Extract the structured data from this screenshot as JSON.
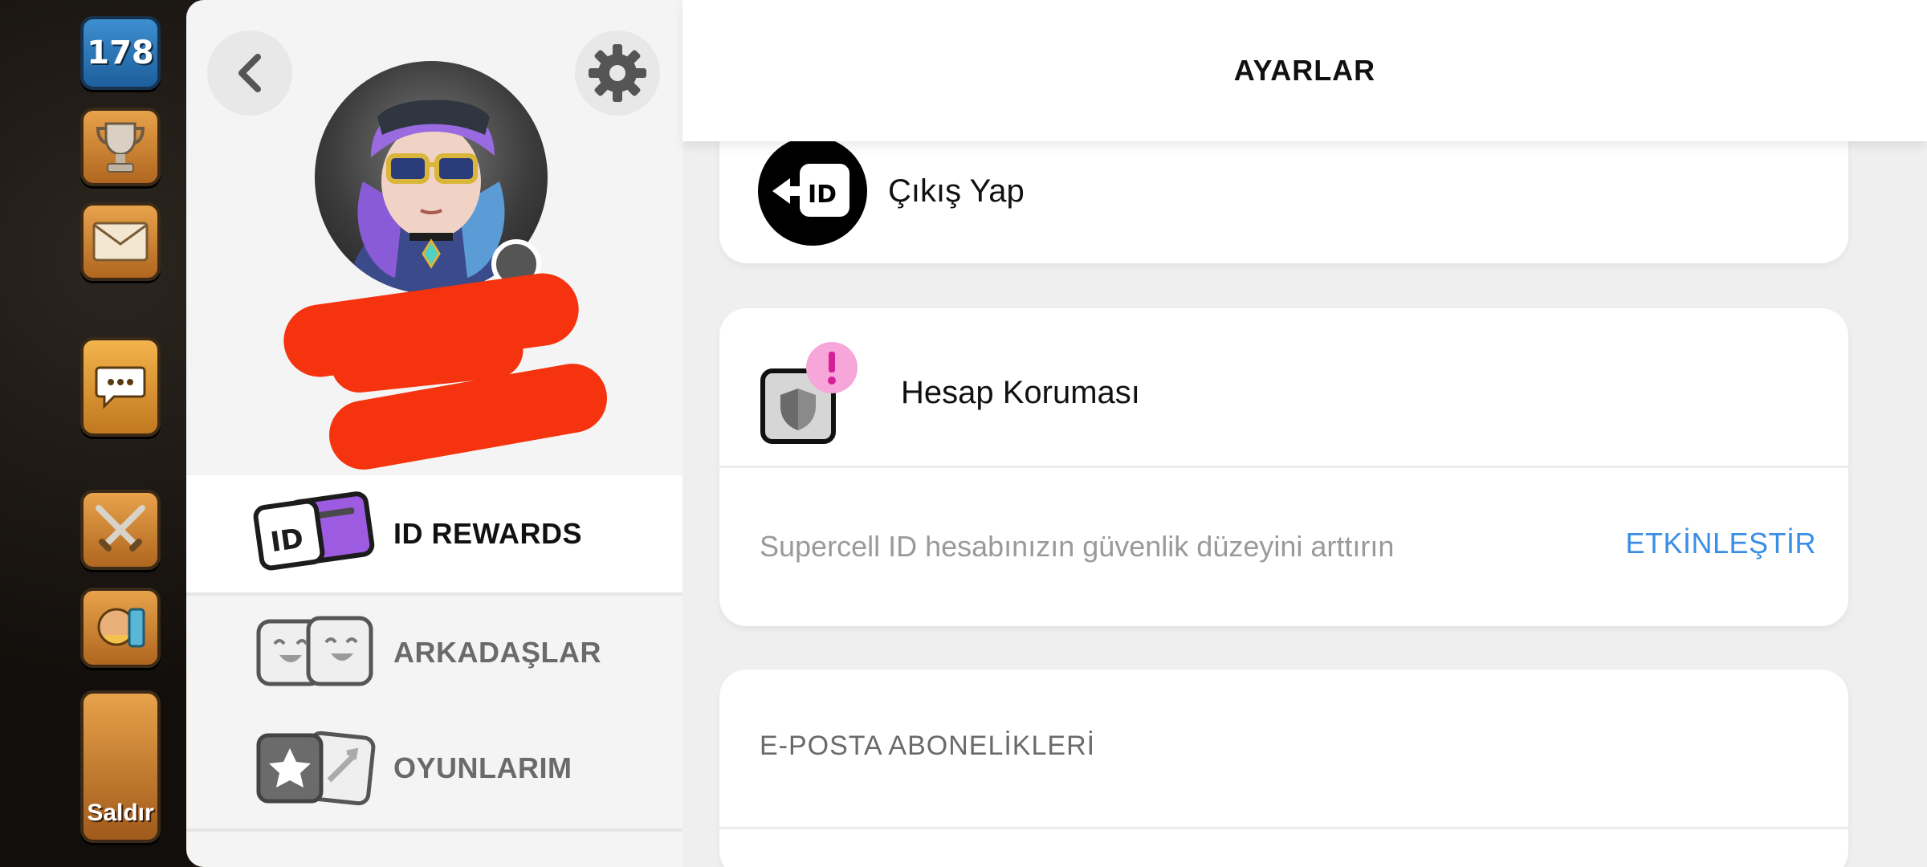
{
  "game_hud": {
    "level": "178",
    "attack_label": "Saldır"
  },
  "profile": {
    "back_icon": "chevron-left-icon",
    "settings_icon": "gear-icon"
  },
  "menu": {
    "items": [
      {
        "label": "ID REWARDS",
        "icon": "id-rewards-icon",
        "active": true
      },
      {
        "label": "ARKADAŞLAR",
        "icon": "friends-icon",
        "active": false
      },
      {
        "label": "OYUNLARIM",
        "icon": "my-games-icon",
        "active": false
      }
    ]
  },
  "settings": {
    "title": "AYARLAR",
    "logout": {
      "label": "Çıkış Yap",
      "icon": "id-logout-icon"
    },
    "protection": {
      "title": "Hesap Koruması",
      "description": "Supercell ID hesabınızın güvenlik düzeyini arttırın",
      "action": "ETKİNLEŞTİR",
      "alert_icon": "exclamation-badge-icon",
      "accent_color": "#3a8ee6"
    },
    "email": {
      "label": "E-POSTA ABONELİKLERİ"
    }
  },
  "colors": {
    "redaction": "#f5330f",
    "alert_badge": "#f6a6d8"
  }
}
